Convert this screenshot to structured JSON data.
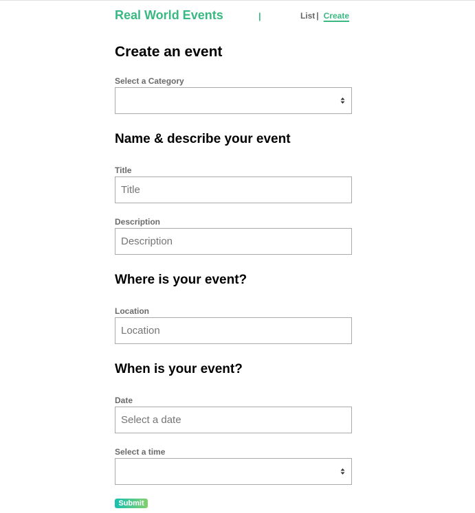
{
  "nav": {
    "brand": "Real World Events",
    "divider": "|",
    "list_label": "List",
    "separator": "|",
    "create_label": "Create"
  },
  "page": {
    "title": "Create an event"
  },
  "category": {
    "label": "Select a Category",
    "value": ""
  },
  "sections": {
    "name_describe": "Name & describe your event",
    "where": "Where is your event?",
    "when": "When is your event?"
  },
  "title_field": {
    "label": "Title",
    "placeholder": "Title",
    "value": ""
  },
  "description_field": {
    "label": "Description",
    "placeholder": "Description",
    "value": ""
  },
  "location_field": {
    "label": "Location",
    "placeholder": "Location",
    "value": ""
  },
  "date_field": {
    "label": "Date",
    "placeholder": "Select a date",
    "value": ""
  },
  "time_field": {
    "label": "Select a time",
    "value": ""
  },
  "submit_label": "Submit",
  "colors": {
    "accent": "#39b982",
    "border": "#a9a9a9",
    "label": "#6a6a6a",
    "submit_gradient_start": "#16c0b0",
    "submit_gradient_end": "#84cf6d"
  }
}
